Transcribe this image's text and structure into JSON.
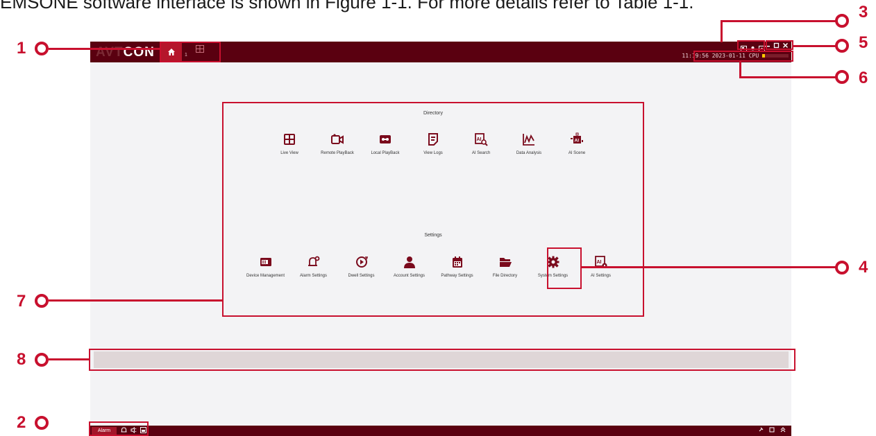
{
  "caption": "EMSONE software interface is shown in Figure 1-1. For more details refer to Table 1-1.",
  "app": {
    "logo_dim": "AVT",
    "logo_main": "CON",
    "tab_live_number": "1",
    "status_time": "11:19:56 2023-01-11 CPU",
    "cpu_usage_percent": 10
  },
  "directory": {
    "title": "Directory",
    "items": [
      {
        "label": "Live View",
        "icon": "grid-icon"
      },
      {
        "label": "Remote PlayBack",
        "icon": "camera-icon"
      },
      {
        "label": "Local PlayBack",
        "icon": "tape-icon"
      },
      {
        "label": "View Logs",
        "icon": "log-icon"
      },
      {
        "label": "AI Search",
        "icon": "ai-search-icon"
      },
      {
        "label": "Data Analysis",
        "icon": "chart-icon"
      },
      {
        "label": "AI Scene",
        "icon": "ai-scene-icon"
      }
    ]
  },
  "settings": {
    "title": "Settings",
    "items": [
      {
        "label": "Device Management",
        "icon": "device-icon"
      },
      {
        "label": "Alarm Settings",
        "icon": "bell-gear-icon"
      },
      {
        "label": "Dwell Settings",
        "icon": "cycle-icon"
      },
      {
        "label": "Account Settings",
        "icon": "user-icon"
      },
      {
        "label": "Pathway Settings",
        "icon": "calendar-icon"
      },
      {
        "label": "File Directory",
        "icon": "folder-icon"
      },
      {
        "label": "System Settings",
        "icon": "gear-icon"
      },
      {
        "label": "AI Settings",
        "icon": "ai-gear-icon"
      }
    ]
  },
  "bottombar": {
    "alarm_label": "Alarm"
  },
  "callouts": [
    "1",
    "2",
    "3",
    "4",
    "5",
    "6",
    "7",
    "8"
  ],
  "colors": {
    "brand": "#5a0010",
    "accent": "#b5152b",
    "annotation": "#c8102e"
  }
}
